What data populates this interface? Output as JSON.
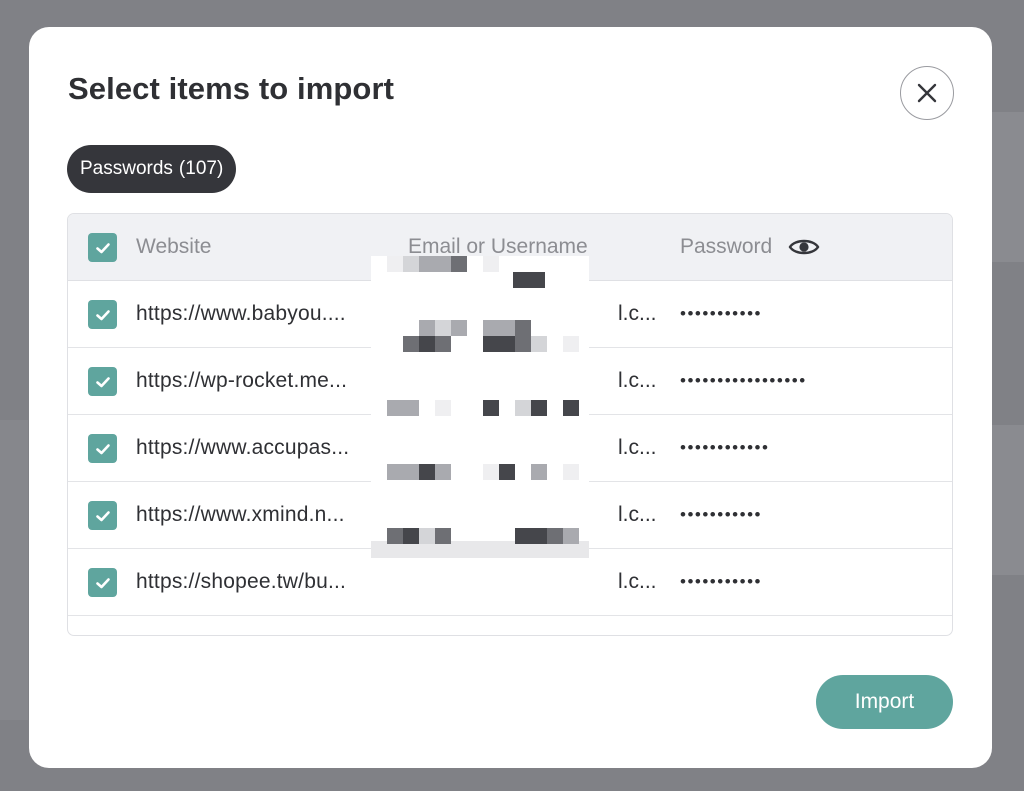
{
  "dialog": {
    "title": "Select items to import",
    "close_label": "close"
  },
  "tab": {
    "label": "Passwords",
    "count": "(107)"
  },
  "table": {
    "headers": {
      "website": "Website",
      "email": "Email or Username",
      "password": "Password"
    },
    "rows": [
      {
        "site": "https://www.babyou....",
        "email": "l.c...",
        "password": "•••••••••••"
      },
      {
        "site": "https://wp-rocket.me...",
        "email": "l.c...",
        "password": "•••••••••••••••••"
      },
      {
        "site": "https://www.accupas...",
        "email": "l.c...",
        "password": "••••••••••••"
      },
      {
        "site": "https://www.xmind.n...",
        "email": "l.c...",
        "password": "•••••••••••"
      },
      {
        "site": "https://shopee.tw/bu...",
        "email": "l.c...",
        "password": "•••••••••••"
      }
    ]
  },
  "footer": {
    "import_label": "Import"
  },
  "colors": {
    "accent": "#5fa59e",
    "pill_bg": "#35363b",
    "overlay": "#808186"
  },
  "icons": {
    "close": "close-icon",
    "eye": "eye-icon",
    "check": "check-icon"
  }
}
